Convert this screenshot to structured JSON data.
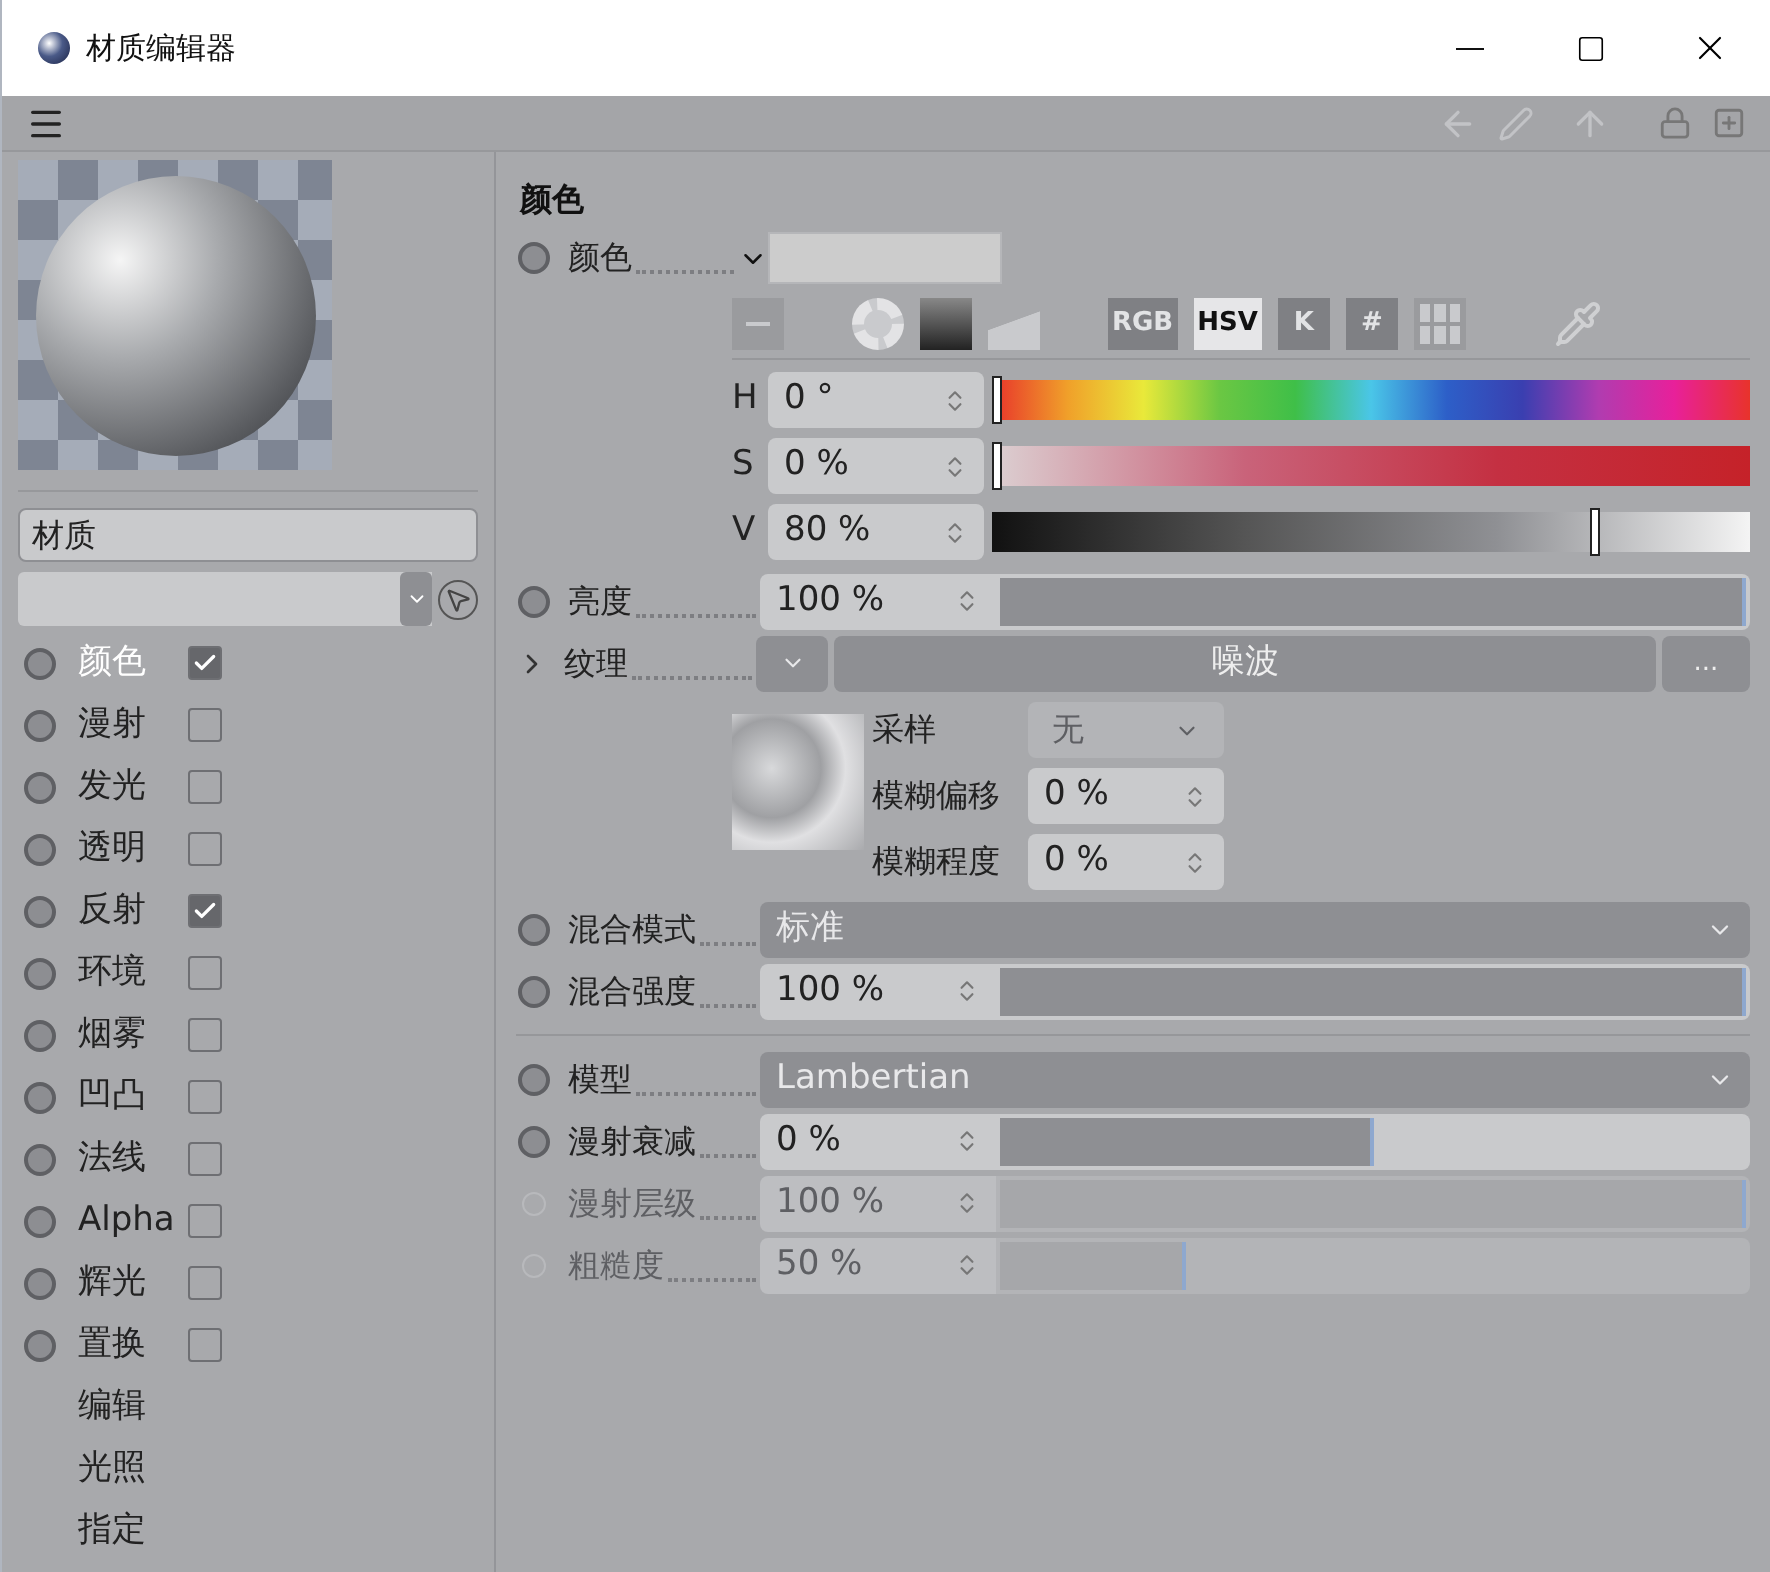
{
  "window": {
    "title": "材质编辑器"
  },
  "material_name": "材质",
  "channels": [
    {
      "kind": "channel",
      "label": "颜色",
      "checked": true,
      "selected": true
    },
    {
      "kind": "channel",
      "label": "漫射",
      "checked": false,
      "selected": false
    },
    {
      "kind": "channel",
      "label": "发光",
      "checked": false,
      "selected": false
    },
    {
      "kind": "channel",
      "label": "透明",
      "checked": false,
      "selected": false
    },
    {
      "kind": "channel",
      "label": "反射",
      "checked": true,
      "selected": false
    },
    {
      "kind": "channel",
      "label": "环境",
      "checked": false,
      "selected": false
    },
    {
      "kind": "channel",
      "label": "烟雾",
      "checked": false,
      "selected": false
    },
    {
      "kind": "channel",
      "label": "凹凸",
      "checked": false,
      "selected": false
    },
    {
      "kind": "channel",
      "label": "法线",
      "checked": false,
      "selected": false
    },
    {
      "kind": "channel",
      "label": "Alpha",
      "checked": false,
      "selected": false
    },
    {
      "kind": "channel",
      "label": "辉光",
      "checked": false,
      "selected": false
    },
    {
      "kind": "channel",
      "label": "置换",
      "checked": false,
      "selected": false
    },
    {
      "kind": "page",
      "label": "编辑",
      "selected": false
    },
    {
      "kind": "page",
      "label": "光照",
      "selected": false
    },
    {
      "kind": "page",
      "label": "指定",
      "selected": false
    }
  ],
  "section_title": "颜色",
  "color_param": {
    "label": "颜色"
  },
  "color_modes": [
    {
      "label": "RGB",
      "selected": false
    },
    {
      "label": "HSV",
      "selected": true
    },
    {
      "label": "K",
      "selected": false
    },
    {
      "label": "#",
      "selected": false
    }
  ],
  "hsv": [
    {
      "label": "H",
      "value": "0 °",
      "level": 0,
      "kind": "hue"
    },
    {
      "label": "S",
      "value": "0 %",
      "level": 0,
      "kind": "saturation"
    },
    {
      "label": "V",
      "value": "80 %",
      "level": 0.8,
      "kind": "value"
    }
  ],
  "layer_params": [
    {
      "kind": "slider",
      "label": "亮度",
      "value": "100 %",
      "level": 1,
      "disabled": false
    },
    {
      "kind": "texture",
      "label": "纹理",
      "expanded": false,
      "shader": "噪波",
      "more": "...",
      "sampling": {
        "label": "采样",
        "value": "无"
      },
      "sub": [
        {
          "label": "模糊偏移",
          "value": "0 %"
        },
        {
          "label": "模糊程度",
          "value": "0 %"
        }
      ]
    },
    {
      "kind": "dropdown",
      "label": "混合模式",
      "value": "标准"
    },
    {
      "kind": "slider",
      "label": "混合强度",
      "value": "100 %",
      "level": 1,
      "disabled": false
    }
  ],
  "model_params": [
    {
      "kind": "dropdown",
      "label": "模型",
      "value": "Lambertian"
    },
    {
      "kind": "slider",
      "label": "漫射衰减",
      "value": "0 %",
      "level": 0.5,
      "disabled": false
    },
    {
      "kind": "slider",
      "label": "漫射层级",
      "value": "100 %",
      "level": 1,
      "disabled": true
    },
    {
      "kind": "slider",
      "label": "粗糙度",
      "value": "50 %",
      "level": 0.25,
      "disabled": true
    }
  ]
}
